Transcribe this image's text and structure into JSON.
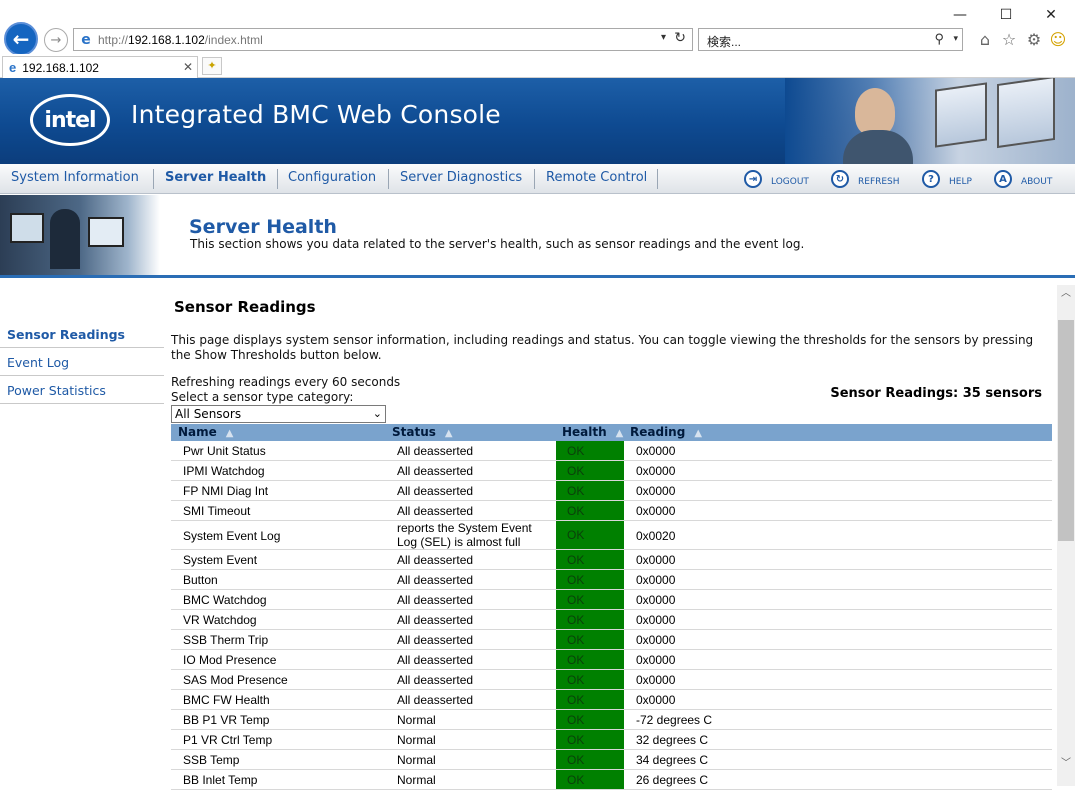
{
  "browser": {
    "url_prefix": "http://",
    "url_host": "192.168.1.102",
    "url_path": "/index.html",
    "search_placeholder": "検索...",
    "tab_title": "192.168.1.102",
    "window_controls": {
      "minimize": "—",
      "maximize": "☐",
      "close": "✕"
    },
    "icons": {
      "home": "home-icon",
      "favorites": "star-icon",
      "tools": "gear-icon",
      "feedback": "smiley-icon"
    }
  },
  "header": {
    "logo_text": "intel",
    "title": "Integrated BMC Web Console",
    "colors": {
      "header_blue": "#0e4a91"
    }
  },
  "nav": {
    "tabs": [
      {
        "label": "System Information"
      },
      {
        "label": "Server Health"
      },
      {
        "label": "Configuration"
      },
      {
        "label": "Server Diagnostics"
      },
      {
        "label": "Remote Control"
      }
    ],
    "active_tab": "Server Health",
    "actions": [
      {
        "label": "LOGOUT",
        "icon": "logout-icon"
      },
      {
        "label": "REFRESH",
        "icon": "refresh-icon"
      },
      {
        "label": "HELP",
        "icon": "help-icon"
      },
      {
        "label": "ABOUT",
        "icon": "about-icon"
      }
    ]
  },
  "banner": {
    "title": "Server Health",
    "description": "This section shows you data related to the server's health, such as sensor readings and the event log."
  },
  "leftnav": {
    "items": [
      {
        "label": "Sensor Readings"
      },
      {
        "label": "Event Log"
      },
      {
        "label": "Power Statistics"
      }
    ],
    "active": "Sensor Readings"
  },
  "content": {
    "title": "Sensor Readings",
    "description": "This page displays system sensor information, including readings and status. You can toggle viewing the thresholds for the sensors by pressing the Show Thresholds button below.",
    "refresh_note": "Refreshing readings every 60 seconds",
    "select_label": "Select a sensor type category:",
    "select_value": "All Sensors",
    "sensor_count": "Sensor Readings: 35 sensors",
    "table": {
      "columns": [
        "Name",
        "Status",
        "Health",
        "Reading"
      ],
      "health_color": "#008000",
      "rows": [
        {
          "name": "Pwr Unit Status",
          "status": "All deasserted",
          "health": "OK",
          "reading": "0x0000"
        },
        {
          "name": "IPMI Watchdog",
          "status": "All deasserted",
          "health": "OK",
          "reading": "0x0000"
        },
        {
          "name": "FP NMI Diag Int",
          "status": "All deasserted",
          "health": "OK",
          "reading": "0x0000"
        },
        {
          "name": "SMI Timeout",
          "status": "All deasserted",
          "health": "OK",
          "reading": "0x0000"
        },
        {
          "name": "System Event Log",
          "status": "reports the System Event Log (SEL) is almost full",
          "health": "OK",
          "reading": "0x0020"
        },
        {
          "name": "System Event",
          "status": "All deasserted",
          "health": "OK",
          "reading": "0x0000"
        },
        {
          "name": "Button",
          "status": "All deasserted",
          "health": "OK",
          "reading": "0x0000"
        },
        {
          "name": "BMC Watchdog",
          "status": "All deasserted",
          "health": "OK",
          "reading": "0x0000"
        },
        {
          "name": "VR Watchdog",
          "status": "All deasserted",
          "health": "OK",
          "reading": "0x0000"
        },
        {
          "name": "SSB Therm Trip",
          "status": "All deasserted",
          "health": "OK",
          "reading": "0x0000"
        },
        {
          "name": "IO Mod Presence",
          "status": "All deasserted",
          "health": "OK",
          "reading": "0x0000"
        },
        {
          "name": "SAS Mod Presence",
          "status": "All deasserted",
          "health": "OK",
          "reading": "0x0000"
        },
        {
          "name": "BMC FW Health",
          "status": "All deasserted",
          "health": "OK",
          "reading": "0x0000"
        },
        {
          "name": "BB P1 VR Temp",
          "status": "Normal",
          "health": "OK",
          "reading": "-72 degrees C"
        },
        {
          "name": "P1 VR Ctrl Temp",
          "status": "Normal",
          "health": "OK",
          "reading": "32 degrees C"
        },
        {
          "name": "SSB Temp",
          "status": "Normal",
          "health": "OK",
          "reading": "34 degrees C"
        },
        {
          "name": "BB Inlet Temp",
          "status": "Normal",
          "health": "OK",
          "reading": "26 degrees C"
        }
      ]
    }
  }
}
